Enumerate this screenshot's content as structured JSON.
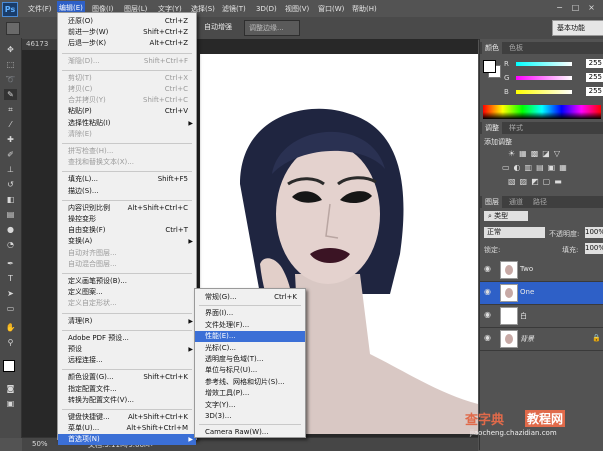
{
  "menubar": {
    "logo": "Ps",
    "items": [
      "文件(F)",
      "编辑(E)",
      "图像(I)",
      "图层(L)",
      "文字(Y)",
      "选择(S)",
      "滤镜(T)",
      "3D(D)",
      "视图(V)",
      "窗口(W)",
      "帮助(H)"
    ],
    "window_controls": [
      "−",
      "□",
      "×"
    ]
  },
  "options_bar": {
    "doc_info": "461",
    "auto_enhance": "自动增强",
    "refine_edge": "调整边缘...",
    "workspace": "基本功能"
  },
  "document": {
    "tab_text": "46173",
    "zoom": "50%",
    "doc_size": "文档:3.11M/9.66M"
  },
  "edit_menu": [
    {
      "label": "还原(O)",
      "shortcut": "Ctrl+Z",
      "disabled": false
    },
    {
      "label": "前进一步(W)",
      "shortcut": "Shift+Ctrl+Z",
      "disabled": false
    },
    {
      "label": "后退一步(K)",
      "shortcut": "Alt+Ctrl+Z",
      "disabled": false
    },
    {
      "sep": true
    },
    {
      "label": "渐隐(D)...",
      "shortcut": "Shift+Ctrl+F",
      "disabled": true
    },
    {
      "sep": true
    },
    {
      "label": "剪切(T)",
      "shortcut": "Ctrl+X",
      "disabled": true
    },
    {
      "label": "拷贝(C)",
      "shortcut": "Ctrl+C",
      "disabled": true
    },
    {
      "label": "合并拷贝(Y)",
      "shortcut": "Shift+Ctrl+C",
      "disabled": true
    },
    {
      "label": "粘贴(P)",
      "shortcut": "Ctrl+V",
      "disabled": false
    },
    {
      "label": "选择性粘贴(I)",
      "shortcut": "",
      "disabled": false,
      "submenu": true
    },
    {
      "label": "清除(E)",
      "shortcut": "",
      "disabled": true
    },
    {
      "sep": true
    },
    {
      "label": "拼写检查(H)...",
      "shortcut": "",
      "disabled": true
    },
    {
      "label": "查找和替换文本(X)...",
      "shortcut": "",
      "disabled": true
    },
    {
      "sep": true
    },
    {
      "label": "填充(L)...",
      "shortcut": "Shift+F5",
      "disabled": false
    },
    {
      "label": "描边(S)...",
      "shortcut": "",
      "disabled": false
    },
    {
      "sep": true
    },
    {
      "label": "内容识别比例",
      "shortcut": "Alt+Shift+Ctrl+C",
      "disabled": false
    },
    {
      "label": "操控变形",
      "shortcut": "",
      "disabled": false
    },
    {
      "label": "自由变换(F)",
      "shortcut": "Ctrl+T",
      "disabled": false
    },
    {
      "label": "变换(A)",
      "shortcut": "",
      "disabled": false,
      "submenu": true
    },
    {
      "label": "自动对齐图层...",
      "shortcut": "",
      "disabled": true
    },
    {
      "label": "自动混合图层...",
      "shortcut": "",
      "disabled": true
    },
    {
      "sep": true
    },
    {
      "label": "定义画笔预设(B)...",
      "shortcut": "",
      "disabled": false
    },
    {
      "label": "定义图案...",
      "shortcut": "",
      "disabled": false
    },
    {
      "label": "定义自定形状...",
      "shortcut": "",
      "disabled": true
    },
    {
      "sep": true
    },
    {
      "label": "清理(R)",
      "shortcut": "",
      "disabled": false,
      "submenu": true
    },
    {
      "sep": true
    },
    {
      "label": "Adobe PDF 预设...",
      "shortcut": "",
      "disabled": false
    },
    {
      "label": "预设",
      "shortcut": "",
      "disabled": false,
      "submenu": true
    },
    {
      "label": "远程连接...",
      "shortcut": "",
      "disabled": false
    },
    {
      "sep": true
    },
    {
      "label": "颜色设置(G)...",
      "shortcut": "Shift+Ctrl+K",
      "disabled": false
    },
    {
      "label": "指定配置文件...",
      "shortcut": "",
      "disabled": false
    },
    {
      "label": "转换为配置文件(V)...",
      "shortcut": "",
      "disabled": false
    },
    {
      "sep": true
    },
    {
      "label": "键盘快捷键...",
      "shortcut": "Alt+Shift+Ctrl+K",
      "disabled": false
    },
    {
      "label": "菜单(U)...",
      "shortcut": "Alt+Shift+Ctrl+M",
      "disabled": false
    },
    {
      "label": "首选项(N)",
      "shortcut": "",
      "disabled": false,
      "submenu": true,
      "highlight": true
    }
  ],
  "prefs_submenu": [
    {
      "label": "常规(G)...",
      "shortcut": "Ctrl+K"
    },
    {
      "sep": true
    },
    {
      "label": "界面(I)...",
      "shortcut": ""
    },
    {
      "label": "文件处理(F)...",
      "shortcut": ""
    },
    {
      "label": "性能(E)...",
      "shortcut": "",
      "highlight": true
    },
    {
      "label": "光标(C)...",
      "shortcut": ""
    },
    {
      "label": "透明度与色域(T)...",
      "shortcut": ""
    },
    {
      "label": "单位与标尺(U)...",
      "shortcut": ""
    },
    {
      "label": "参考线、网格和切片(S)...",
      "shortcut": ""
    },
    {
      "label": "增效工具(P)...",
      "shortcut": ""
    },
    {
      "label": "文字(Y)...",
      "shortcut": ""
    },
    {
      "label": "3D(3)...",
      "shortcut": ""
    },
    {
      "sep": true
    },
    {
      "label": "Camera Raw(W)...",
      "shortcut": ""
    }
  ],
  "color_panel": {
    "tabs": [
      "颜色",
      "色板"
    ],
    "r_label": "R",
    "g_label": "G",
    "b_label": "B",
    "r": "255",
    "g": "255",
    "b": "255"
  },
  "adjust_panel": {
    "tabs": [
      "调整",
      "样式"
    ],
    "title": "添加调整"
  },
  "layers_panel": {
    "tabs": [
      "图层",
      "通道",
      "路径"
    ],
    "filter": "类型",
    "blend_mode": "正常",
    "opacity_label": "不透明度:",
    "opacity": "100%",
    "lock_label": "锁定:",
    "fill_label": "填充:",
    "fill": "100%",
    "layers": [
      {
        "name": "Two",
        "selected": false,
        "thumb": "portrait"
      },
      {
        "name": "One",
        "selected": true,
        "thumb": "portrait"
      },
      {
        "name": "白",
        "selected": false,
        "thumb": "white"
      },
      {
        "name": "背景",
        "selected": false,
        "thumb": "portrait",
        "locked": true
      }
    ]
  },
  "watermark": {
    "brand": "查字典",
    "brand2": "教程网",
    "url": "jiaocheng.chazidian.com"
  },
  "colors": {
    "menu_highlight": "#3b6fd6",
    "selected_layer": "#2e60c7",
    "watermark": "#e06a4a"
  }
}
